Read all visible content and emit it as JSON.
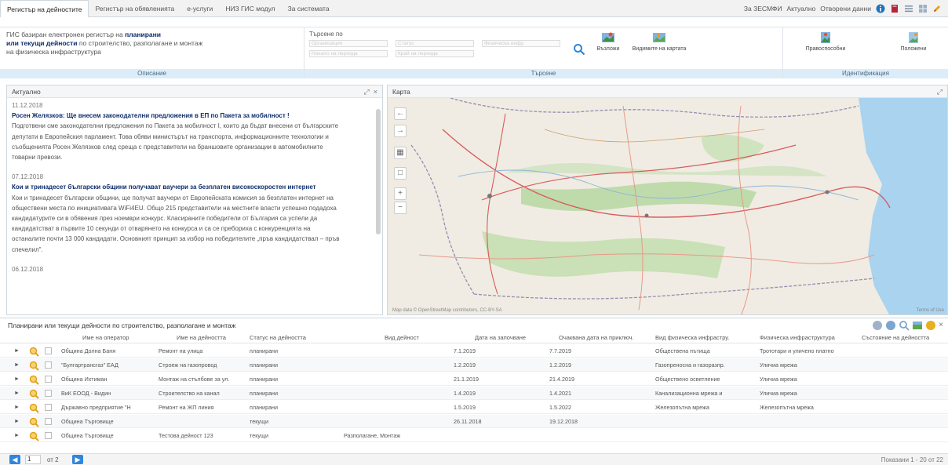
{
  "tabs": [
    {
      "label": "Регистър на дейностите",
      "active": true
    },
    {
      "label": "Регистър на обявленията",
      "active": false
    },
    {
      "label": "е-услуги",
      "active": false
    },
    {
      "label": "НИЗ ГИС модул",
      "active": false
    },
    {
      "label": "За системата",
      "active": false
    }
  ],
  "top_links": {
    "about": "За ЗЕСМФИ",
    "current": "Актуално",
    "open_data": "Отворени данни"
  },
  "top_icons": [
    "info-icon",
    "book-icon",
    "list-icon",
    "grid-icon",
    "edit-icon"
  ],
  "ribbon": {
    "description": {
      "line1_plain": "ГИС базиран електронен регистър на ",
      "line1_bold": "планирани",
      "line2_bold": "или текущи дейности",
      "line2_plain": " по строителство, разполагане и монтаж",
      "line3": "на физическа инфраструктура",
      "footer": "Описание"
    },
    "search": {
      "label": "Търсене по",
      "fields": [
        "Организация",
        "Статус",
        "Физическа инфр.",
        "Начало на периода",
        "Край на периода"
      ],
      "search_icon": "search-icon",
      "buttons": [
        "Възложи",
        "Видимите на картата"
      ],
      "footer": "Търсене"
    },
    "identification": {
      "buttons": [
        "Правоспособни",
        "Положени"
      ],
      "footer": "Идентификация"
    }
  },
  "news_panel": {
    "title": "Актуално",
    "items": [
      {
        "date": "11.12.2018",
        "title": "Росен Желязков: Ще внесем законодателни предложения в ЕП по Пакета за мобилност !",
        "lines": [
          "Подготвени сме законодателни предложения по Пакета за мобилност I, които да бъдат внесени от българските",
          "депутати в Европейския парламент. Това обяви министърът на транспорта, информационните технологии и",
          "съобщенията Росен Желязков след среща с представители на браншовите организации в автомобилните",
          "товарни превози."
        ]
      },
      {
        "date": "07.12.2018",
        "title": "Кои и тринадесет български общини получават ваучери за безплатен високоскоростен интернет",
        "lines": [
          "Кои и тринадесет български общини, ще получат ваучери от Европейската комисия за безплатен интернет на",
          "обществени места по инициативата WiFi4EU. Общо 215 представители на местните власти успешно подадоха",
          "кандидатурите си в обявения през ноември конкурс. Класираните победители от България са успели да",
          "кандидатстват в първите 10 секунди от отварянето на конкурса и са се пребориха с конкуренцията на",
          "останалите почти 13 000 кандидати. Основният принцип за избор на победителите „пръв кандидатствал – пръв",
          "спечелил\"."
        ]
      },
      {
        "date": "06.12.2018",
        "title": "",
        "lines": []
      }
    ]
  },
  "map_panel": {
    "title": "Карта",
    "controls": [
      "arrow-left-icon",
      "arrow-right-icon",
      "layers-icon",
      "zoom-in-icon",
      "zoom-out-icon"
    ],
    "attribution": "Map data © OpenStreetMap contributors, CC-BY-SA",
    "attribution_right": "Terms of Use"
  },
  "grid": {
    "title": "Планирани или текущи дейности по строителство, разполагане и монтаж",
    "columns": [
      "Име на оператор",
      "Име на дейността",
      "Статус на дейността",
      "Вид дейност",
      "Дата на започване",
      "Очаквана дата на приключ.",
      "Вид физическа инфрастру.",
      "Физическа инфраструктура",
      "Състояние на дейността"
    ],
    "rows": [
      [
        "Община Долна Баня",
        "Ремонт на улица",
        "планирани",
        "",
        "7.1.2019",
        "7.7.2019",
        "Обществена пътища",
        "Трототари и уличено платно",
        ""
      ],
      [
        "\"Булгартрансгаз\" ЕАД",
        "Строеж на газопровод",
        "планирани",
        "",
        "1.2.2019",
        "1.2.2019",
        "Газопреносна и газоразпр.",
        "Уличиа мрежа",
        ""
      ],
      [
        "Община Ихтиман",
        "Монтаж на стълбове за ул.",
        "планирани",
        "",
        "21.1.2019",
        "21.4.2019",
        "Обществено осветление",
        "Уличиа мрежа",
        ""
      ],
      [
        "ВиК ЕООД - Видин",
        "Строителство на канал",
        "планирани",
        "",
        "1.4.2019",
        "1.4.2021",
        "Канализационна мрежа и",
        "Уличиа мрежа",
        ""
      ],
      [
        "Държавно предприятие \"Н",
        "Ремонт на ЖП линия",
        "планирани",
        "",
        "1.5.2019",
        "1.5.2022",
        "Железопътна мрежа",
        "Железопътна мрежа",
        ""
      ],
      [
        "Община Търговище",
        "",
        "текущи",
        "",
        "26.11.2018",
        "19.12.2018",
        "",
        "",
        ""
      ],
      [
        "Община Търговище",
        "Тестова дейност 123",
        "текущи",
        "Разполагане, Монтаж",
        "",
        "",
        "",
        "",
        ""
      ]
    ],
    "toolbar_icons": [
      "save-icon",
      "print-icon",
      "search-icon",
      "map-icon",
      "help-icon",
      "close-icon"
    ]
  },
  "pager": {
    "page": "1",
    "of": "от 2",
    "showing": "Показани 1 - 20 от 22"
  }
}
